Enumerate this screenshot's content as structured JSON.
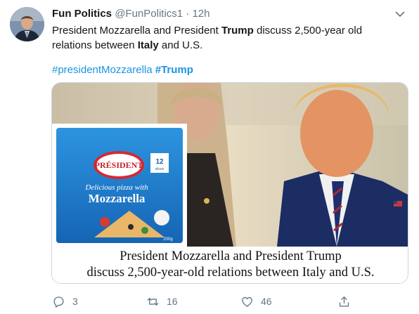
{
  "tweet": {
    "display_name": "Fun Politics",
    "handle": "@FunPolitics1",
    "separator": "·",
    "time": "12h",
    "text": {
      "p1": "President Mozzarella and President ",
      "b1": "Trump",
      "p2": " discuss 2,500-year old relations between ",
      "b2": "Italy",
      "p3": " and U.S."
    },
    "hashtags": [
      "#presidentMozzarella",
      "#Trump"
    ]
  },
  "media": {
    "package_brand": "PRÉSIDENT",
    "package_tagline": "Delicious pizza with",
    "package_product": "Mozzarella",
    "package_count": "12",
    "package_count_unit": "slices",
    "package_weight": "200g",
    "caption_line1": "President Mozzarella and President Trump",
    "caption_line2": "discuss 2,500-year-old relations between Italy and U.S."
  },
  "actions": {
    "reply_count": "3",
    "retweet_count": "16",
    "like_count": "46"
  },
  "colors": {
    "link": "#1b95e0",
    "secondary": "#657786",
    "text": "#14171a",
    "package_blue": "#1f7fcf"
  },
  "icons": {
    "caret": "chevron-down-icon",
    "reply": "reply-icon",
    "retweet": "retweet-icon",
    "like": "heart-icon",
    "share": "share-icon"
  }
}
